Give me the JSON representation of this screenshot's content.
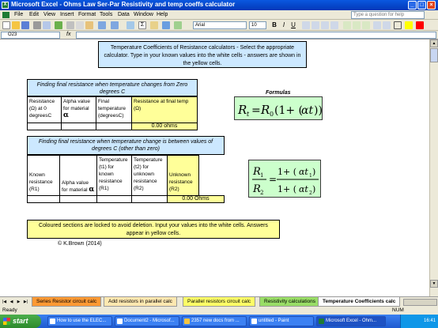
{
  "window": {
    "title": "Microsoft Excel - Ohms Law Ser-Par Resistivity and temp coeffs calculator",
    "app_icon": "excel-icon"
  },
  "menu": [
    "File",
    "Edit",
    "View",
    "Insert",
    "Format",
    "Tools",
    "Data",
    "Window",
    "Help"
  ],
  "help_placeholder": "Type a question for help",
  "toolbar": {
    "font": "Arial",
    "size": "10"
  },
  "formula_bar": {
    "name_box": "O23",
    "fx": "fx",
    "formula": ""
  },
  "sheet": {
    "intro": "Temperature Coefficients of Resistance calculators - Select the appropriate calculator. Type in your known values into the white cells - answers are shown in the yellow cells.",
    "section1": {
      "header": "Finding final resistance when temperature changes from Zero degrees C",
      "cols": [
        "Resistance (Ω) at 0 degreesC",
        "Alpha value for material",
        "Final temperature (degreesC)",
        "Resistance at final temp (Ω)"
      ],
      "alpha_symbol": "α",
      "result": "0.00 ohms"
    },
    "section2": {
      "header": "Finding final resistance when temperature change is between values of degrees C (other than zero)",
      "cols": [
        "Known resistance (R1)",
        "Alpha value for material",
        "Temperature (t1) for known resistance (R1)",
        "Temperature (t2) for unknown resistance (R2)",
        "Unknown resistance (R2)"
      ],
      "alpha_symbol": "α",
      "result": "0.00 Ohms"
    },
    "formulas_title": "Formulas",
    "note": "Coloured sections are locked to avoid deletion. Input your values into the white cells. Answers appear in yellow cells.",
    "copyright": "© K.Brown (2014)"
  },
  "tabs": [
    "Series Resistor circuit calc",
    "Add resistors in parallel calc",
    "Parallel resistors circuit calc",
    "Resistivity calculations",
    "Temperature Coefficients calc"
  ],
  "active_tab": 4,
  "status": {
    "left": "Ready",
    "right": "NUM"
  },
  "taskbar": {
    "start": "start",
    "items": [
      "How to use the ELEC...",
      "Document2 - Microsof...",
      "2357 new docs from ...",
      "untitled - Paint",
      "Microsoft Excel - Ohm..."
    ],
    "clock": "16:41"
  },
  "colors": {
    "yellow": "#ffff99",
    "blue_box": "#cce8ff",
    "green_panel": "#ccffcc"
  }
}
